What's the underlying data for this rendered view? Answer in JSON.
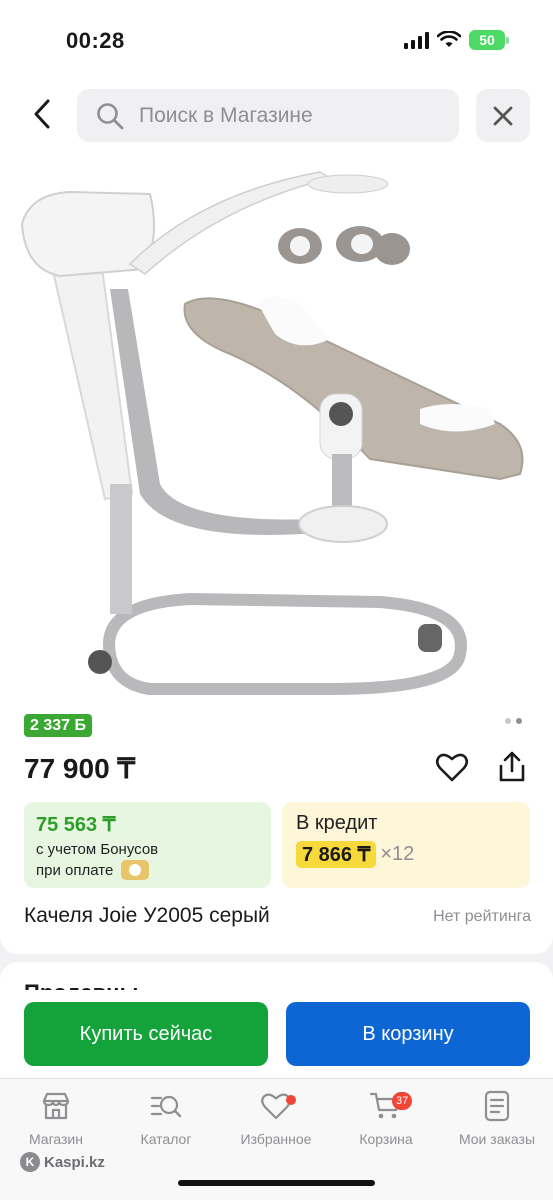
{
  "status_bar": {
    "time": "00:28",
    "battery": "50"
  },
  "search": {
    "placeholder": "Поиск в Магазине"
  },
  "product": {
    "bonus_badge": "2 337 Б",
    "price": "77 900 ₸",
    "bonus_price": "75 563 ₸",
    "bonus_note_line1": "с учетом Бонусов",
    "bonus_note_line2": "при оплате",
    "credit_title": "В кредит",
    "credit_amount": "7 866 ₸",
    "credit_months": "×12",
    "title": "Качеля Joie У2005 серый",
    "rating": "Нет рейтинга",
    "image_pages": 2,
    "active_page": 2
  },
  "sellers": {
    "title": "Продавцы"
  },
  "actions": {
    "buy_now": "Купить сейчас",
    "add_to_cart": "В корзину"
  },
  "colors": {
    "green": "#13a33a",
    "blue": "#0d66d3",
    "credit_yellow": "#f7d93b",
    "badge_red": "#f14635"
  },
  "tabs": [
    {
      "label": "Магазин",
      "icon": "store-icon"
    },
    {
      "label": "Каталог",
      "icon": "catalog-search-icon"
    },
    {
      "label": "Избранное",
      "icon": "heart-icon",
      "dot": true
    },
    {
      "label": "Корзина",
      "icon": "cart-icon",
      "badge": "37"
    },
    {
      "label": "Мои заказы",
      "icon": "orders-icon"
    }
  ],
  "watermark": {
    "text": "Kaspi.kz",
    "logo_letter": "K"
  }
}
